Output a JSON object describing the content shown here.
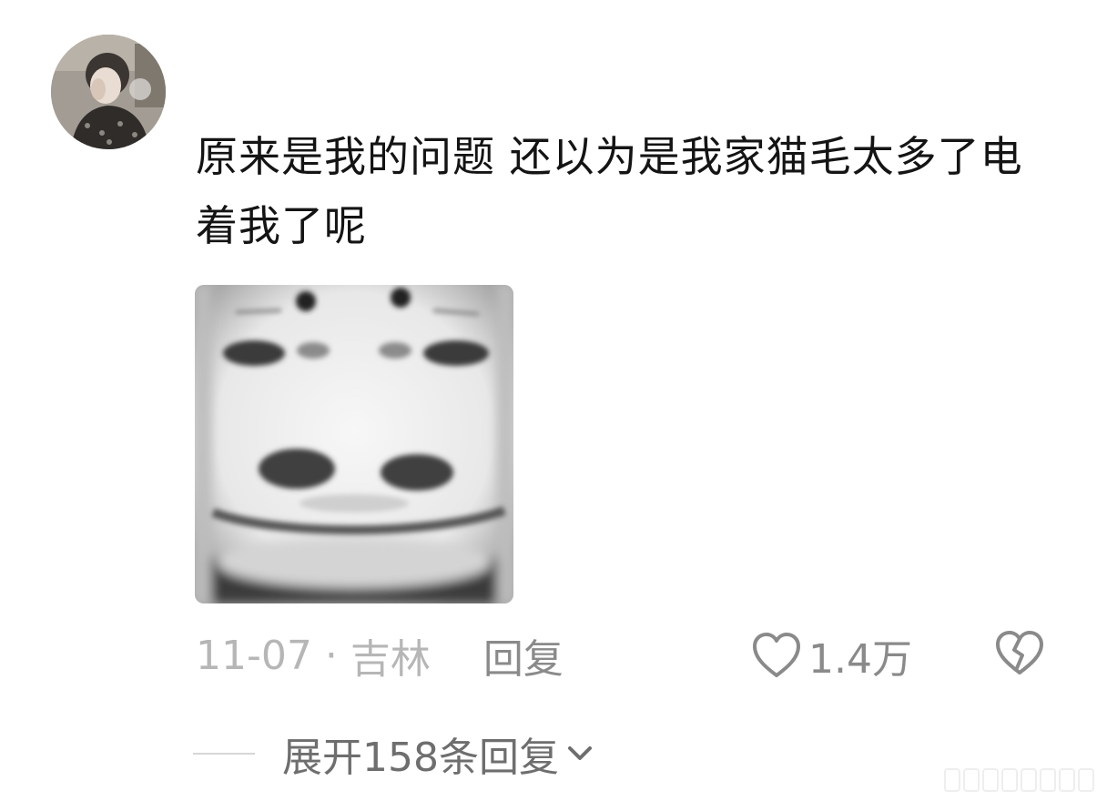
{
  "comment": {
    "text": "原来是我的问题 还以为是我家猫毛太多了电着我了呢",
    "date": "11-07",
    "separator": "·",
    "location": "吉林",
    "reply_label": "回复",
    "like_count": "1.4万",
    "expand_label": "展开158条回复"
  },
  "icons": {
    "like": "heart-outline-icon",
    "dislike": "broken-heart-icon",
    "expand": "chevron-down-icon"
  },
  "colors": {
    "text_primary": "#141414",
    "text_meta": "#b6b6b6",
    "text_action": "#8a8a8a",
    "text_expand": "#6e6e6e"
  }
}
